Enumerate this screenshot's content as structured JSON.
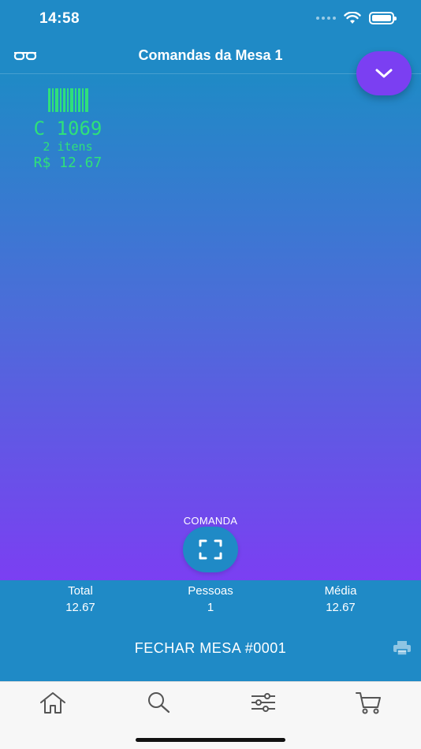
{
  "status_bar": {
    "time": "14:58"
  },
  "nav": {
    "title": "Comandas da Mesa 1"
  },
  "ticket": {
    "code": "C 1069",
    "items": "2 itens",
    "total": "R$ 12.67"
  },
  "scan": {
    "label": "COMANDA"
  },
  "summary": {
    "total_label": "Total",
    "total_value": "12.67",
    "people_label": "Pessoas",
    "people_value": "1",
    "average_label": "Média",
    "average_value": "12.67"
  },
  "close_button": {
    "label": "FECHAR MESA #0001"
  },
  "icons": {
    "glasses": "glasses-icon",
    "chevron": "chevron-down-icon",
    "scan": "scan-frame-icon",
    "print": "printer-icon",
    "home": "home-icon",
    "search": "search-icon",
    "filters": "sliders-icon",
    "cart": "cart-icon"
  },
  "colors": {
    "primary": "#1f8ac6",
    "accent": "#7b3ff2",
    "ticket_text": "#2fe07a",
    "tab_bar": "#f7f7f7"
  }
}
